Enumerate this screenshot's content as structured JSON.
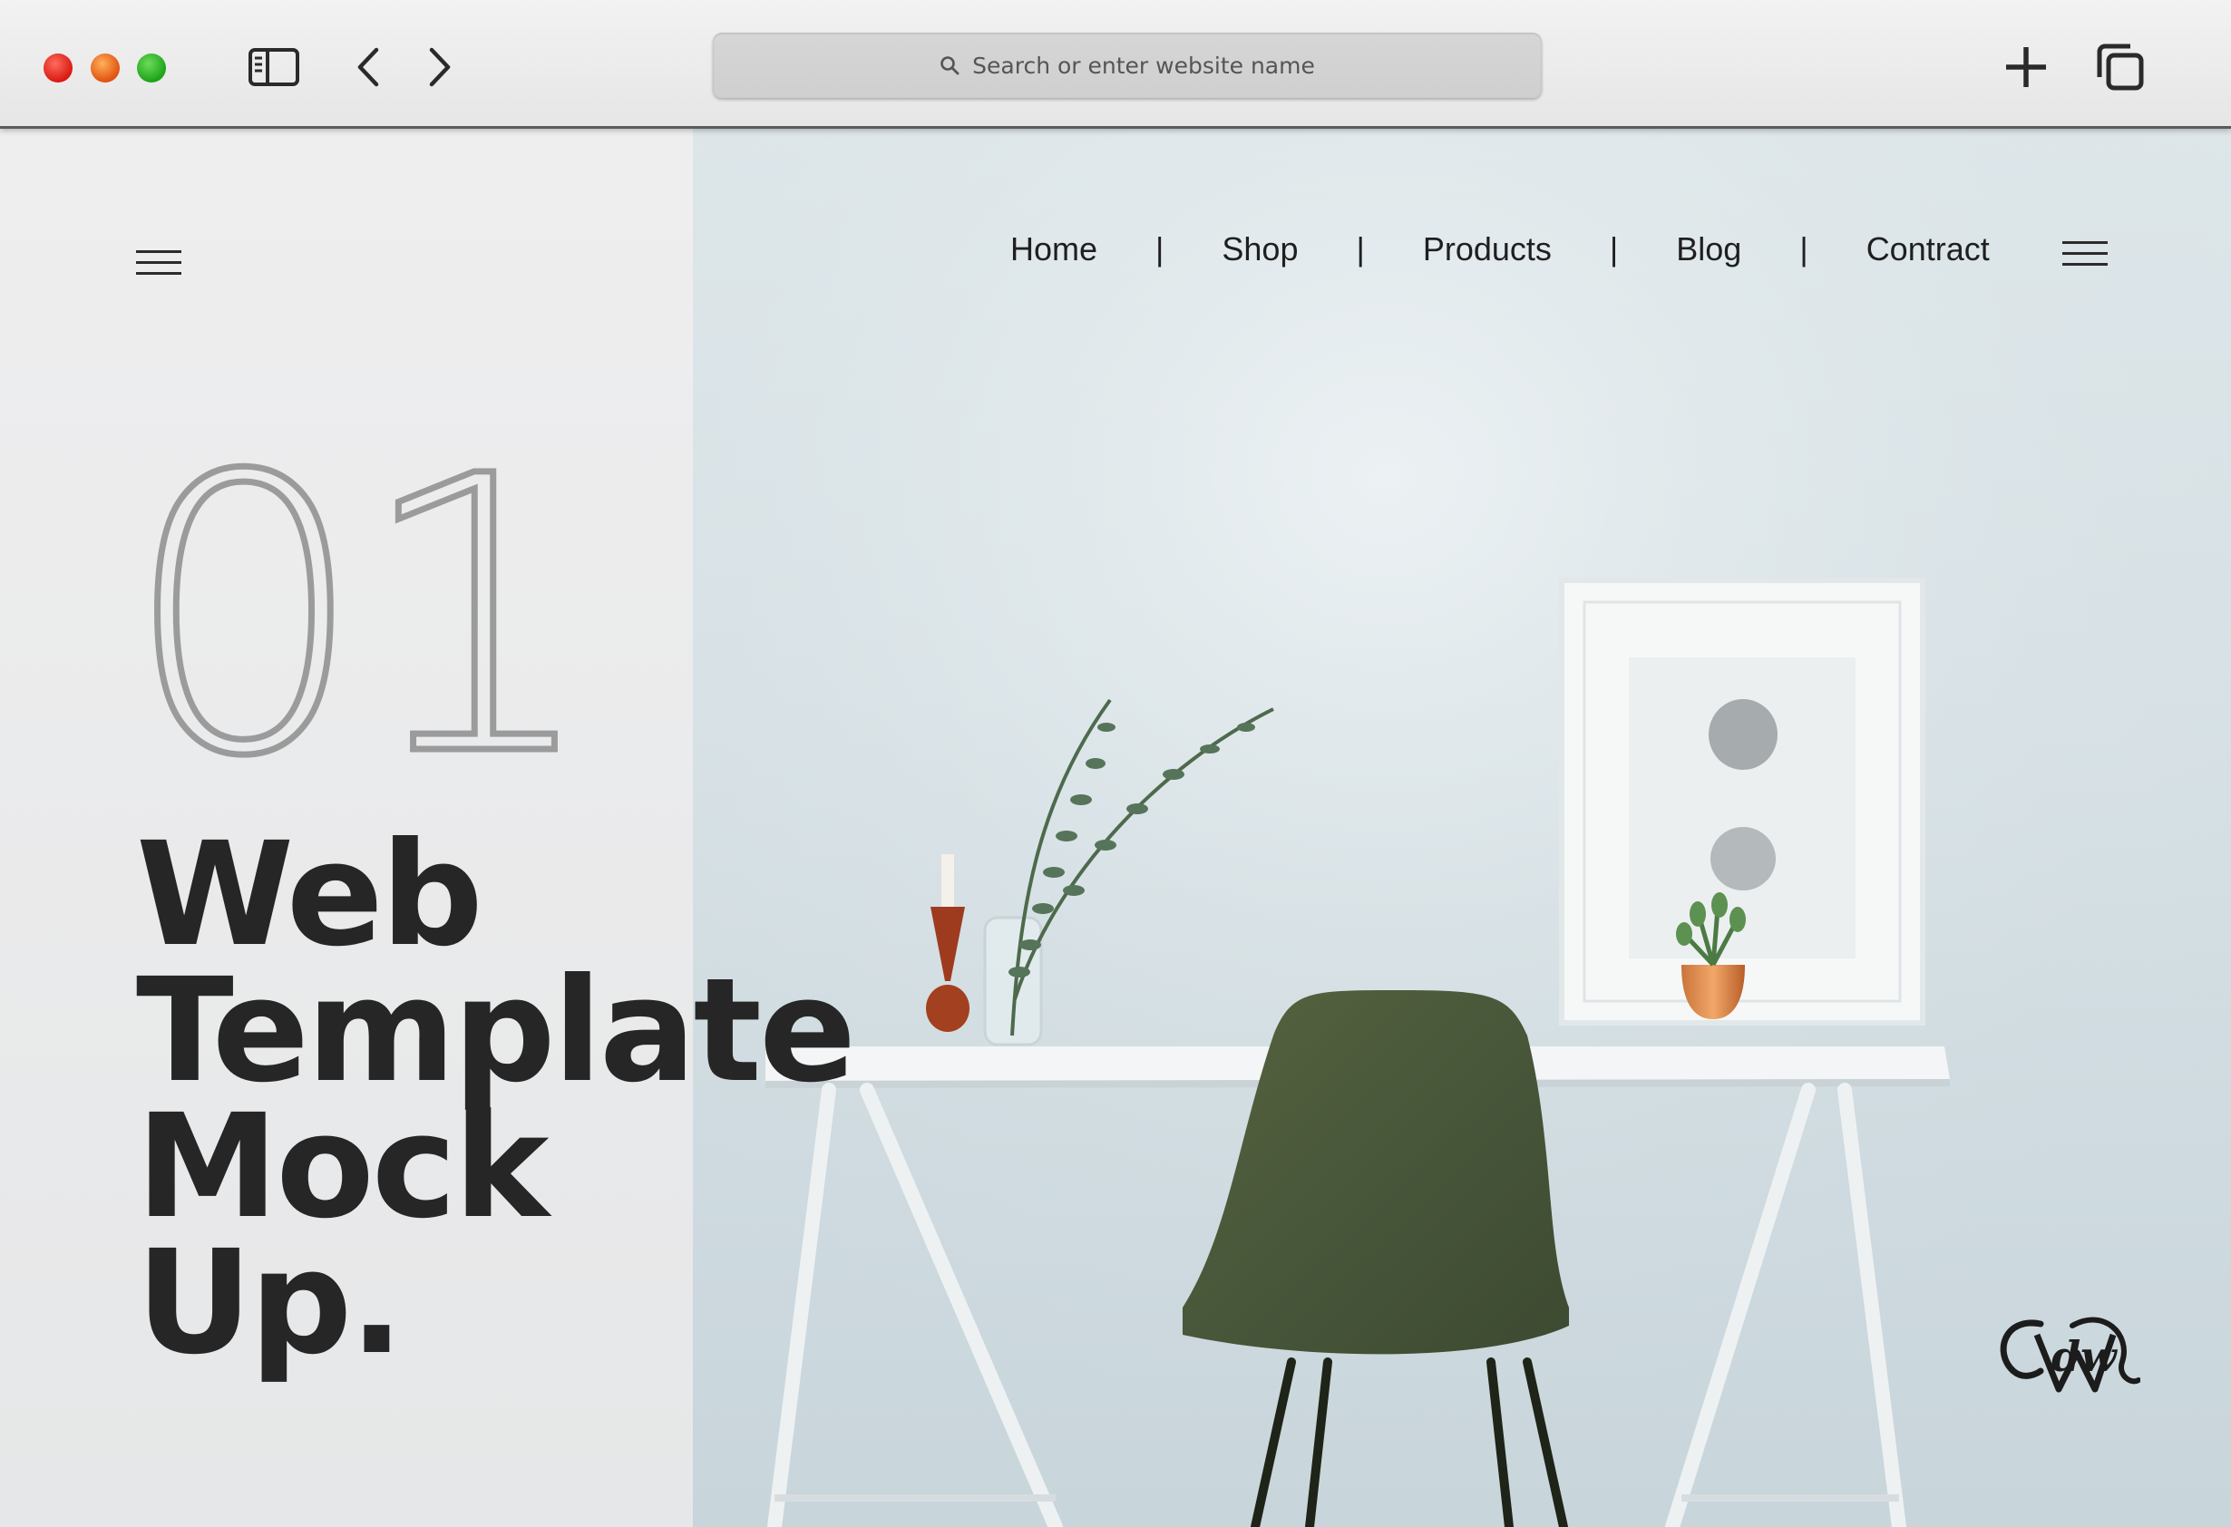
{
  "browser": {
    "address_placeholder": "Search or enter website name",
    "icons": [
      "close-window",
      "minimize-window",
      "maximize-window",
      "sidebar-toggle-icon",
      "back-chevron-icon",
      "forward-chevron-icon",
      "search-icon",
      "new-tab-plus-icon",
      "tabs-overview-icon"
    ]
  },
  "site": {
    "nav": {
      "items": [
        "Home",
        "Shop",
        "Products",
        "Blog",
        "Contract"
      ],
      "separator": "|"
    },
    "hero": {
      "number": "01",
      "headline": [
        "Web",
        "Template",
        "Mock",
        "Up."
      ]
    },
    "logo_text": "dw"
  },
  "colors": {
    "traffic_red": "#e0241a",
    "traffic_yellow": "#e8621a",
    "traffic_green": "#2db12a",
    "headline": "#262626",
    "number_outline": "#9b9b9b",
    "chair": "#4c5a3c"
  }
}
